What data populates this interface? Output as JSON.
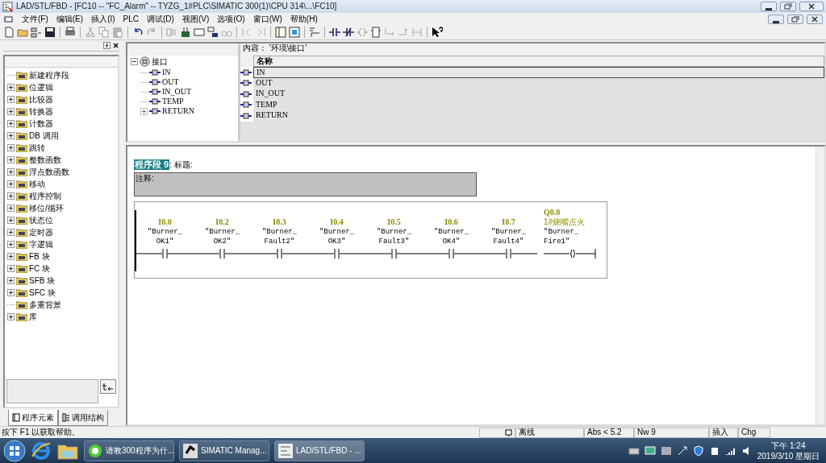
{
  "window": {
    "title": "LAD/STL/FBD  - [FC10 -- \"FC_Alarm\" -- TYZG_1#PLC\\SIMATIC 300(1)\\CPU 314\\...\\FC10]"
  },
  "menu": [
    "文件(F)",
    "编辑(E)",
    "插入(I)",
    "PLC",
    "调试(D)",
    "视图(V)",
    "选项(O)",
    "窗口(W)",
    "帮助(H)"
  ],
  "elements_panel": {
    "items": [
      {
        "label": "新建程序段",
        "expandable": false
      },
      {
        "label": "位逻辑",
        "expandable": true
      },
      {
        "label": "比较器",
        "expandable": true
      },
      {
        "label": "转换器",
        "expandable": true
      },
      {
        "label": "计数器",
        "expandable": true
      },
      {
        "label": "DB 调用",
        "expandable": true
      },
      {
        "label": "跳转",
        "expandable": true
      },
      {
        "label": "整数函数",
        "expandable": true
      },
      {
        "label": "浮点数函数",
        "expandable": true
      },
      {
        "label": "移动",
        "expandable": true
      },
      {
        "label": "程序控制",
        "expandable": true
      },
      {
        "label": "移位/循环",
        "expandable": true
      },
      {
        "label": "状态位",
        "expandable": true
      },
      {
        "label": "定时器",
        "expandable": true
      },
      {
        "label": "字逻辑",
        "expandable": true
      },
      {
        "label": "FB 块",
        "expandable": true
      },
      {
        "label": "FC 块",
        "expandable": true
      },
      {
        "label": "SFB 块",
        "expandable": true
      },
      {
        "label": "SFC 块",
        "expandable": true
      },
      {
        "label": "多重背景",
        "expandable": false
      },
      {
        "label": "库",
        "expandable": true
      }
    ],
    "tabs": [
      {
        "label": "程序元素",
        "selected": true
      },
      {
        "label": "调用结构",
        "selected": false
      }
    ]
  },
  "interface": {
    "tree": {
      "label": "接口",
      "expanded": true,
      "children": [
        {
          "label": "IN",
          "expandable": false
        },
        {
          "label": "OUT",
          "expandable": false
        },
        {
          "label": "IN_OUT",
          "expandable": false
        },
        {
          "label": "TEMP",
          "expandable": false
        },
        {
          "label": "RETURN",
          "expandable": true
        }
      ]
    },
    "content_label": "内容： '环境\\接口'",
    "column": "名称",
    "rows": [
      {
        "name": "IN",
        "selected": true
      },
      {
        "name": "OUT",
        "selected": false
      },
      {
        "name": "IN_OUT",
        "selected": false
      },
      {
        "name": "TEMP",
        "selected": false
      },
      {
        "name": "RETURN",
        "selected": false
      }
    ]
  },
  "network": {
    "number": "程序段 9",
    "title": ": 标题:",
    "comment": "注释:",
    "elements": [
      {
        "kind": "contact",
        "address": "I0.0",
        "symbol": [
          "\"Burner_",
          "OK1\""
        ]
      },
      {
        "kind": "contact",
        "address": "I0.2",
        "symbol": [
          "\"Burner_",
          "OK2\""
        ]
      },
      {
        "kind": "contact",
        "address": "I0.3",
        "symbol": [
          "\"Burner_",
          "Fault2\""
        ]
      },
      {
        "kind": "contact",
        "address": "I0.4",
        "symbol": [
          "\"Burner_",
          "OK3\""
        ]
      },
      {
        "kind": "contact",
        "address": "I0.5",
        "symbol": [
          "\"Burner_",
          "Fault3\""
        ]
      },
      {
        "kind": "contact",
        "address": "I0.6",
        "symbol": [
          "\"Burner_",
          "OK4\""
        ]
      },
      {
        "kind": "contact",
        "address": "I0.7",
        "symbol": [
          "\"Burner_",
          "Fault4\""
        ]
      },
      {
        "kind": "coil",
        "address": "Q0.0",
        "comment": "1#烧嘴点火",
        "symbol": [
          "\"Burner_",
          "Fire1\""
        ]
      }
    ]
  },
  "status_bar": {
    "help": "按下 F1 以获取帮助。",
    "mode": "离线",
    "position": "Abs < 5.2",
    "network": "Nw 9",
    "insert": "插入",
    "change": "Chg"
  },
  "taskbar": {
    "tasks": [
      {
        "label": "请教300程序为什...",
        "selected": false
      },
      {
        "label": "SIMATIC Manag...",
        "selected": false
      },
      {
        "label": "LAD/STL/FBD  - ...",
        "selected": true
      }
    ],
    "time": "下午 1:24",
    "date": "2019/3/10 星期日"
  }
}
